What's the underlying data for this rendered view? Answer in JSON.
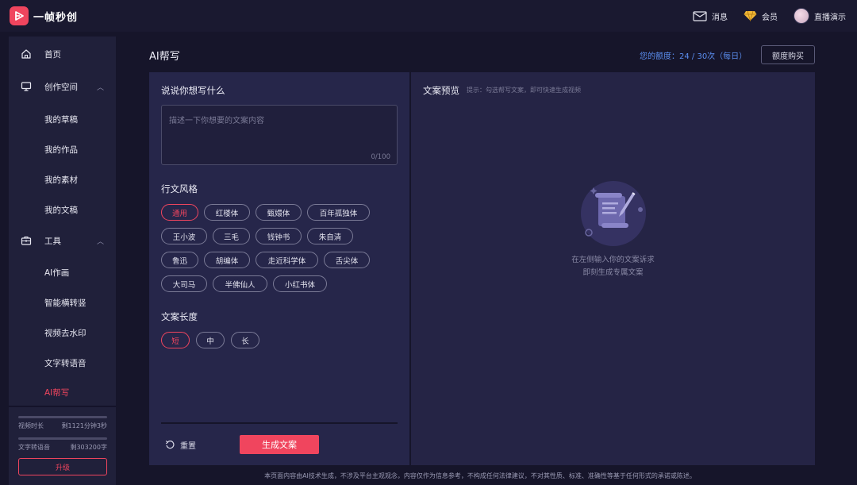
{
  "header": {
    "app_name": "一帧秒创",
    "messages_label": "消息",
    "member_label": "会员",
    "user_name": "直播演示"
  },
  "sidebar": {
    "items": [
      {
        "label": "首页",
        "icon": "home-icon"
      },
      {
        "label": "创作空间",
        "icon": "monitor-icon",
        "expanded": true
      },
      {
        "label": "我的草稿"
      },
      {
        "label": "我的作品"
      },
      {
        "label": "我的素材"
      },
      {
        "label": "我的文稿"
      },
      {
        "label": "工具",
        "icon": "toolbox-icon",
        "expanded": true
      },
      {
        "label": "AI作画"
      },
      {
        "label": "智能横转竖"
      },
      {
        "label": "视频去水印"
      },
      {
        "label": "文字转语音"
      },
      {
        "label": "AI帮写",
        "active": true
      }
    ],
    "quota": {
      "video_label": "视频时长",
      "video_value": "剩1121分钟3秒",
      "tts_label": "文字转语音",
      "tts_value": "剩303200字"
    },
    "upgrade_label": "升级"
  },
  "main": {
    "title": "AI帮写",
    "quota_text": "您的额度：24 / 30次（每日）",
    "buy_label": "额度购买",
    "prompt_label": "说说你想写什么",
    "prompt_placeholder": "描述一下你想要的文案内容",
    "prompt_count": "0/100",
    "style_label": "行文风格",
    "styles": [
      "通用",
      "红楼体",
      "甄嬛体",
      "百年孤独体",
      "王小波",
      "三毛",
      "钱钟书",
      "朱自清",
      "鲁迅",
      "胡编体",
      "走近科学体",
      "舌尖体",
      "大司马",
      "半佛仙人",
      "小红书体"
    ],
    "selected_style": "通用",
    "length_label": "文案长度",
    "lengths": [
      "短",
      "中",
      "长"
    ],
    "selected_length": "短",
    "reset_label": "重置",
    "generate_label": "生成文案"
  },
  "preview": {
    "title": "文案预览",
    "hint": "提示：勾选帮写文案，即可快速生成视频",
    "empty_line1": "在左侧输入你的文案诉求",
    "empty_line2": "即刻生成专属文案"
  },
  "footer": {
    "disclaimer": "本页面内容由AI技术生成，不涉及平台主观观念，内容仅作为信息参考，不构成任何法律建议，不对其性质、标准、准确性等基于任何形式的承诺或陈述。"
  },
  "colors": {
    "accent": "#f0455e",
    "link": "#5b8ef0",
    "background": "#16152a",
    "panel": "#26264a"
  }
}
